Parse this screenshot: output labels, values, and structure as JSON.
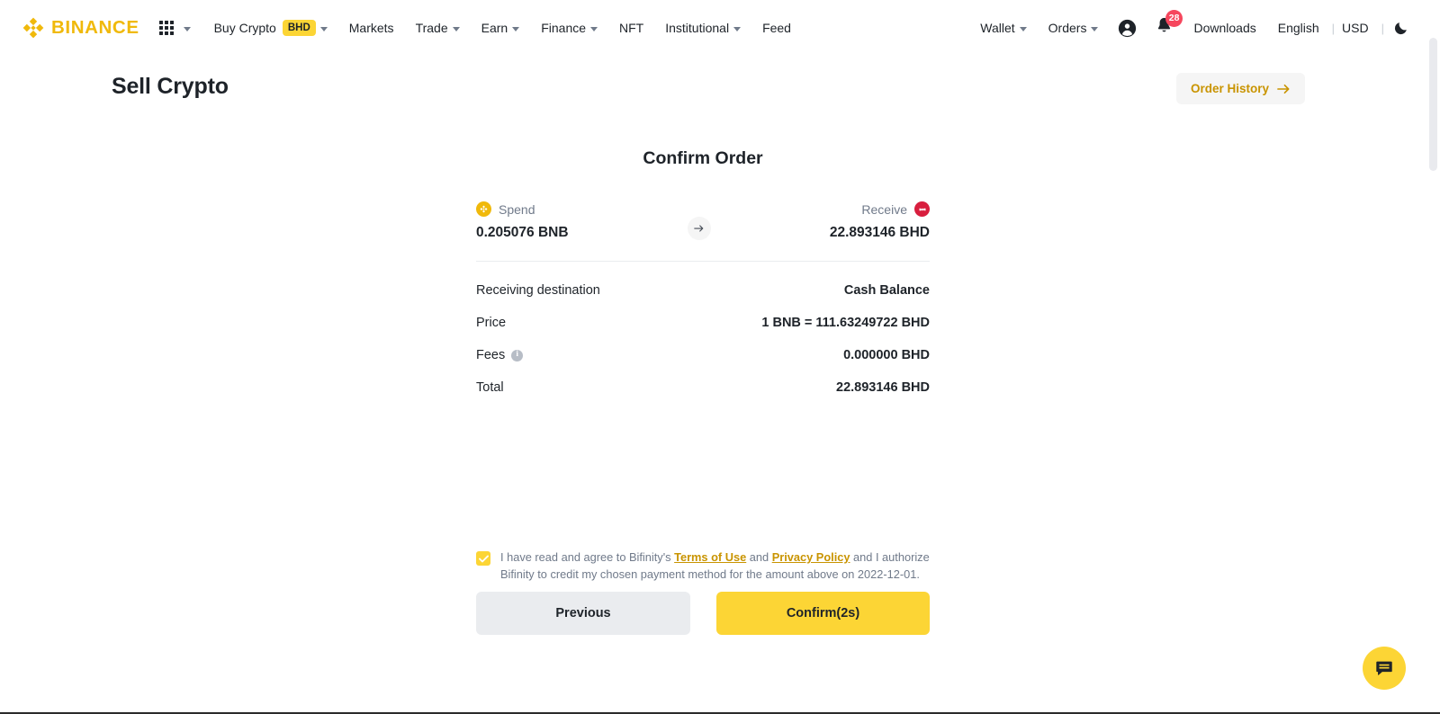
{
  "nav": {
    "brand": "BINANCE",
    "apps_icon": "grid-apps-icon",
    "items": [
      {
        "label": "Buy Crypto",
        "badge": "BHD",
        "caret": true
      },
      {
        "label": "Markets",
        "caret": false
      },
      {
        "label": "Trade",
        "caret": true
      },
      {
        "label": "Earn",
        "caret": true
      },
      {
        "label": "Finance",
        "caret": true
      },
      {
        "label": "NFT",
        "caret": false
      },
      {
        "label": "Institutional",
        "caret": true
      },
      {
        "label": "Feed",
        "caret": false
      }
    ],
    "right": {
      "wallet": "Wallet",
      "orders": "Orders",
      "profile_icon": "user-profile-icon",
      "bell_icon": "notification-bell-icon",
      "notification_count": "28",
      "downloads": "Downloads",
      "language": "English",
      "currency": "USD",
      "separator": "|",
      "theme_icon": "moon-dark-mode-icon"
    }
  },
  "header": {
    "title": "Sell Crypto",
    "order_history_label": "Order History",
    "order_history_icon": "arrow-right-icon"
  },
  "card": {
    "title": "Confirm Order",
    "spend": {
      "label": "Spend",
      "amount": "0.205076 BNB",
      "coin_icon": "bnb-coin-icon"
    },
    "swap_icon": "arrow-right-icon",
    "receive": {
      "label": "Receive",
      "amount": "22.893146 BHD",
      "coin_icon": "bhd-currency-icon"
    },
    "details": [
      {
        "label": "Receiving destination",
        "value": "Cash Balance",
        "info": false
      },
      {
        "label": "Price",
        "value": "1 BNB = 111.63249722 BHD",
        "info": false
      },
      {
        "label": "Fees",
        "value": "0.000000 BHD",
        "info": true
      },
      {
        "label": "Total",
        "value": "22.893146 BHD",
        "info": false
      }
    ],
    "fees_info_icon": "info-tooltip-icon"
  },
  "terms": {
    "checked": true,
    "checkbox_icon": "checkmark-icon",
    "part1": "I have read and agree to Bifinity's ",
    "link1": "Terms of Use",
    "part2": " and ",
    "link2": "Privacy Policy",
    "part3": " and I authorize Bifinity to credit my chosen payment method for the amount above on 2022-12-01."
  },
  "actions": {
    "previous_label": "Previous",
    "confirm_label": "Confirm(2s)"
  },
  "chat": {
    "icon": "chat-bubble-icon"
  },
  "colors": {
    "brand_yellow": "#F0B90B",
    "button_yellow": "#FCD535",
    "link_gold": "#C99400",
    "text_primary": "#1E2329",
    "text_secondary": "#707A8A",
    "notification_red": "#F6465D",
    "bhd_red": "#D81E3E",
    "divider": "#EAECEF"
  }
}
